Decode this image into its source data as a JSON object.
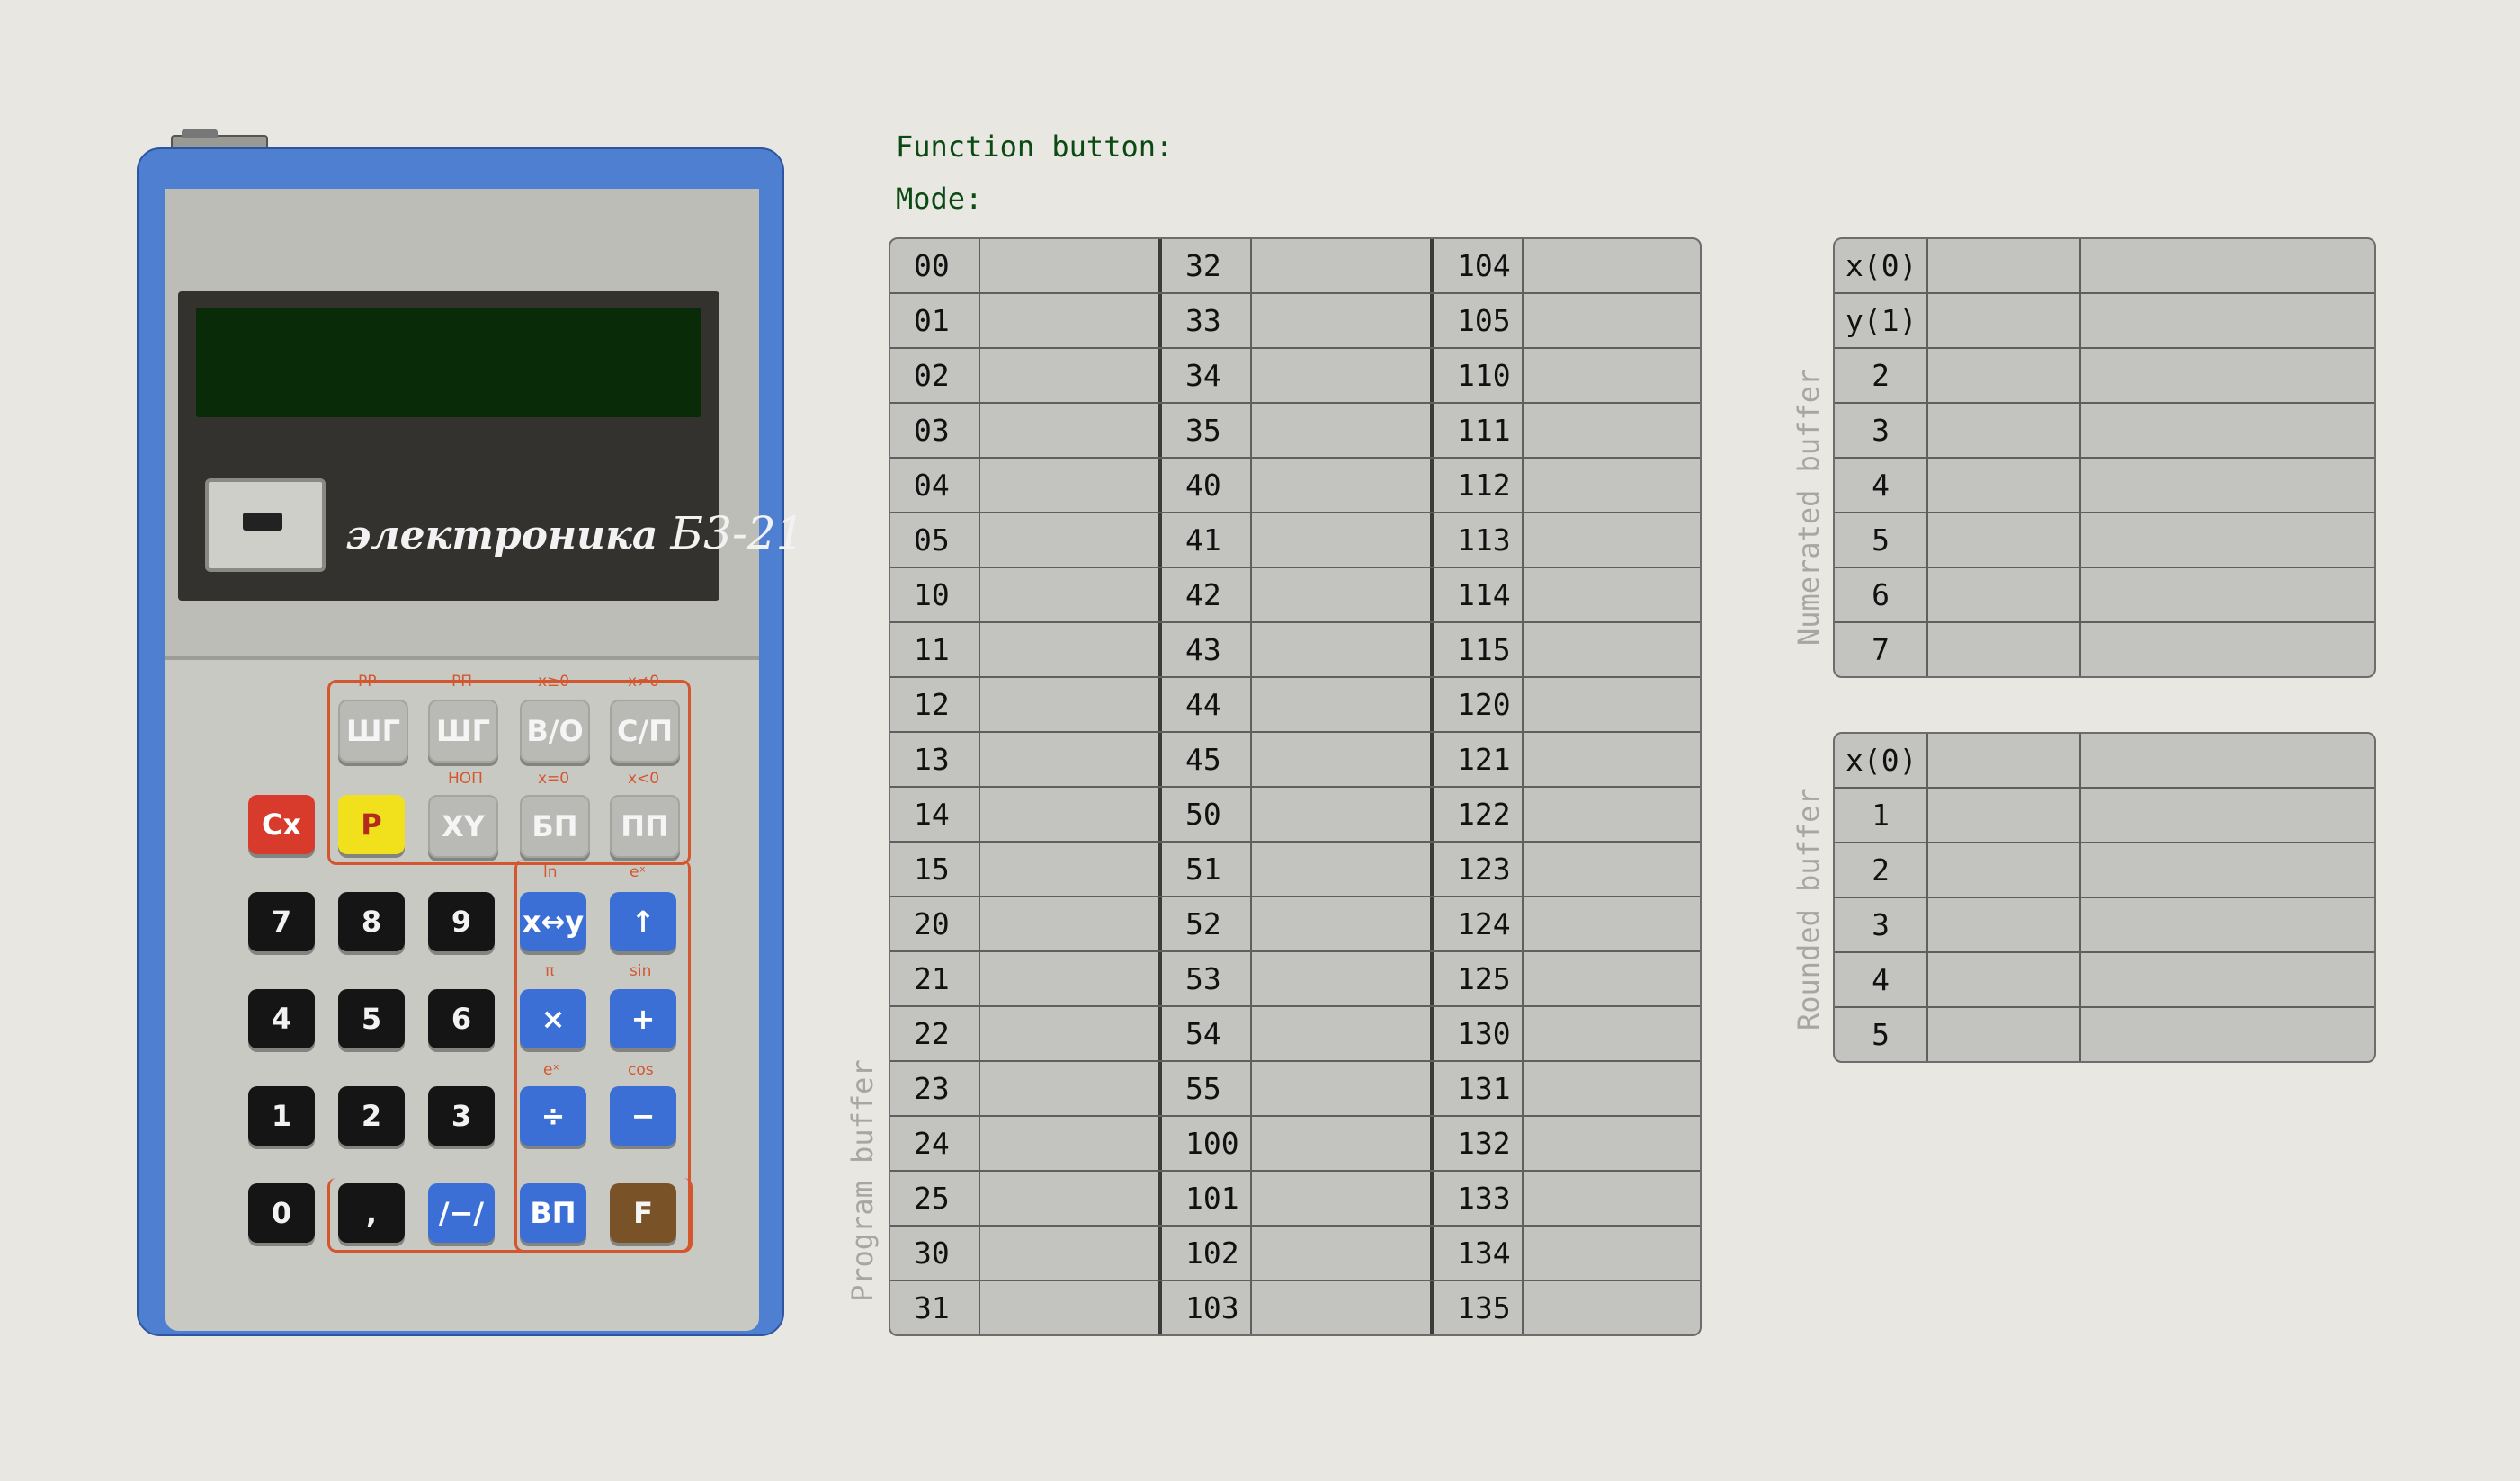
{
  "status": {
    "function_button_label": "Function button:",
    "mode_label": "Mode:"
  },
  "calculator": {
    "brand": "электроника",
    "model": "Б3-21",
    "top_labels": [
      "РР",
      "РП",
      "x≥0",
      "x≠0"
    ],
    "mid_labels": [
      "НОП",
      "x=0",
      "x<0"
    ],
    "func_labels": [
      "ln",
      "eˣ",
      "π",
      "sin",
      "eˣ",
      "cos"
    ],
    "keys_row1": [
      "ШГ",
      "ШГ",
      "В/О",
      "С/П"
    ],
    "keys_row2": [
      "Cx",
      "P",
      "XY",
      "БП",
      "ПП"
    ],
    "keys_row3": [
      "7",
      "8",
      "9",
      "x↔y",
      "↑"
    ],
    "keys_row4": [
      "4",
      "5",
      "6",
      "×",
      "+"
    ],
    "keys_row5": [
      "1",
      "2",
      "3",
      "÷",
      "−"
    ],
    "keys_row6": [
      "0",
      ",",
      "/−/",
      "ВП",
      "F"
    ]
  },
  "program_buffer": {
    "label": "Program buffer",
    "col1": [
      "00",
      "01",
      "02",
      "03",
      "04",
      "05",
      "10",
      "11",
      "12",
      "13",
      "14",
      "15",
      "20",
      "21",
      "22",
      "23",
      "24",
      "25",
      "30",
      "31"
    ],
    "col2": [
      "32",
      "33",
      "34",
      "35",
      "40",
      "41",
      "42",
      "43",
      "44",
      "45",
      "50",
      "51",
      "52",
      "53",
      "54",
      "55",
      "100",
      "101",
      "102",
      "103"
    ],
    "col3": [
      "104",
      "105",
      "110",
      "111",
      "112",
      "113",
      "114",
      "115",
      "120",
      "121",
      "122",
      "123",
      "124",
      "125",
      "130",
      "131",
      "132",
      "133",
      "134",
      "135"
    ]
  },
  "numerated_buffer": {
    "label": "Numerated buffer",
    "rows": [
      "x(0)",
      "y(1)",
      "2",
      "3",
      "4",
      "5",
      "6",
      "7"
    ]
  },
  "rounded_buffer": {
    "label": "Rounded buffer",
    "rows": [
      "x(0)",
      "1",
      "2",
      "3",
      "4",
      "5"
    ]
  }
}
